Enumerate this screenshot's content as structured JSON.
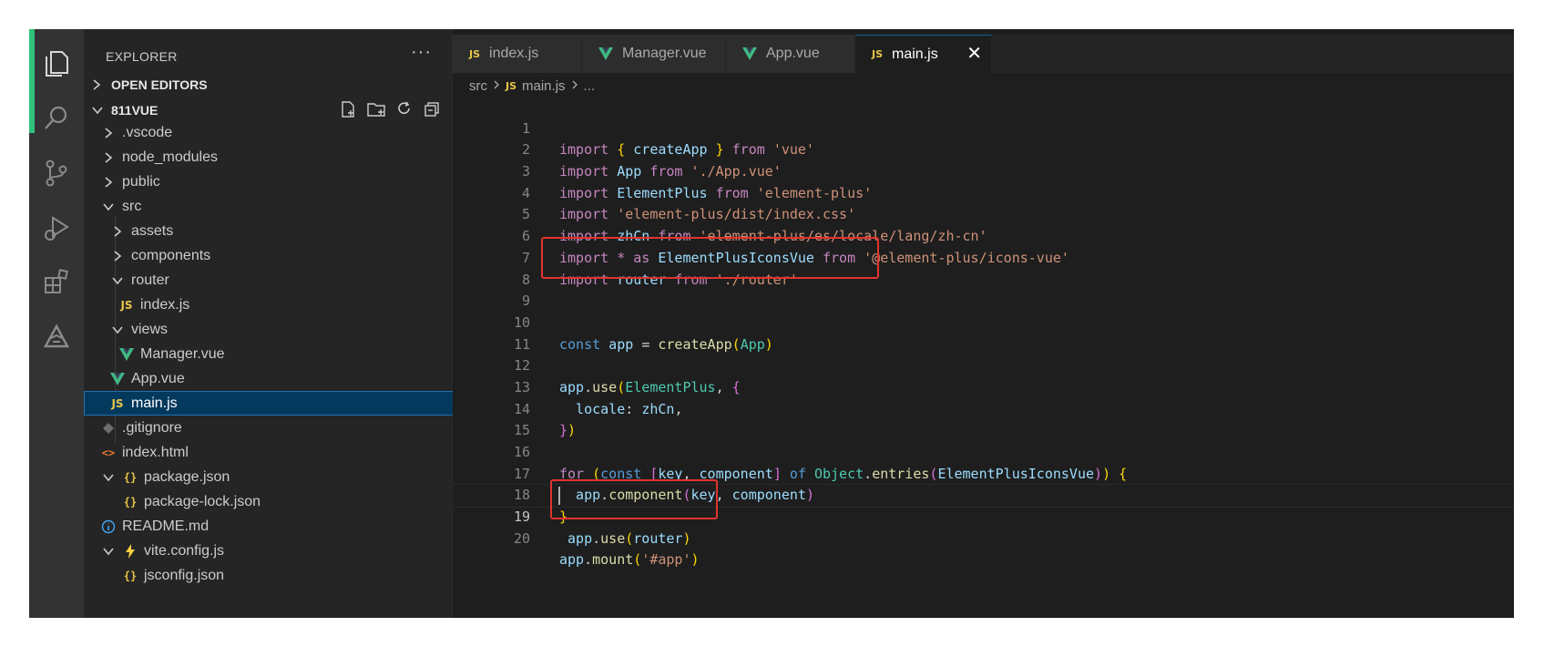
{
  "sidebar": {
    "header": "EXPLORER",
    "more": "···",
    "open_editors": "OPEN EDITORS",
    "project": "811VUE",
    "tree": [
      {
        "label": ".vscode",
        "icon": "chevron-right-icon"
      },
      {
        "label": "node_modules",
        "icon": "chevron-right-icon"
      },
      {
        "label": "public",
        "icon": "chevron-right-icon"
      },
      {
        "label": "src",
        "icon": "chevron-down-icon"
      },
      {
        "label": "assets",
        "icon": "chevron-right-icon"
      },
      {
        "label": "components",
        "icon": "chevron-right-icon"
      },
      {
        "label": "router",
        "icon": "chevron-down-icon"
      },
      {
        "label": "index.js",
        "icon": "js-file-icon"
      },
      {
        "label": "views",
        "icon": "chevron-down-icon"
      },
      {
        "label": "Manager.vue",
        "icon": "vue-file-icon"
      },
      {
        "label": "App.vue",
        "icon": "vue-file-icon"
      },
      {
        "label": "main.js",
        "icon": "js-file-icon"
      },
      {
        "label": ".gitignore",
        "icon": "git-file-icon"
      },
      {
        "label": "index.html",
        "icon": "html-file-icon"
      },
      {
        "label": "package.json",
        "icon": "json-file-icon"
      },
      {
        "label": "package-lock.json",
        "icon": "json-file-icon"
      },
      {
        "label": "README.md",
        "icon": "info-file-icon"
      },
      {
        "label": "vite.config.js",
        "icon": "vite-file-icon"
      },
      {
        "label": "jsconfig.json",
        "icon": "json-file-icon"
      }
    ]
  },
  "tabs": [
    {
      "label": "index.js",
      "icon": "js-file-icon"
    },
    {
      "label": "Manager.vue",
      "icon": "vue-file-icon"
    },
    {
      "label": "App.vue",
      "icon": "vue-file-icon"
    },
    {
      "label": "main.js",
      "icon": "js-file-icon"
    }
  ],
  "breadcrumb": {
    "folder": "src",
    "file": "main.js",
    "rest": "..."
  },
  "icons": {
    "js": "JS",
    "json": "{}",
    "html": "<>"
  },
  "colors": {
    "accent": "#2ec27e",
    "highlight": "#e2332d",
    "selection": "#04395e"
  },
  "code": {
    "line_numbers": [
      "1",
      "2",
      "3",
      "4",
      "5",
      "6",
      "7",
      "8",
      "9",
      "10",
      "11",
      "12",
      "13",
      "14",
      "15",
      "16",
      "17",
      "18",
      "19",
      "20"
    ],
    "l1": [
      "import",
      " ",
      "{",
      " createApp ",
      "}",
      " from ",
      "'vue'"
    ],
    "l2": [
      "import",
      " App ",
      "from",
      " './App.vue'"
    ],
    "l3": [
      "import",
      " ElementPlus ",
      "from",
      " 'element-plus'"
    ],
    "l4": [
      "import",
      " 'element-plus/dist/index.css'"
    ],
    "l5": [
      "import",
      " zhCn ",
      "from",
      " 'element-plus/es/locale/lang/zh-cn'"
    ],
    "l6": [
      "import",
      " * as ",
      "ElementPlusIconsVue",
      " from ",
      "'@element-plus/icons-vue'"
    ],
    "l7": [
      "import",
      " router ",
      "from",
      " './router'"
    ],
    "l10": [
      "const",
      " app ",
      "= ",
      "createApp",
      "(",
      "App",
      ")"
    ],
    "l12": [
      "app",
      ".",
      "use",
      "(",
      "ElementPlus",
      ", ",
      "{"
    ],
    "l13": [
      "  locale",
      ": ",
      "zhCn",
      ","
    ],
    "l14": [
      "}",
      ")"
    ],
    "l16": [
      "for",
      " ",
      "(",
      "const",
      " ",
      "[",
      "key",
      ", ",
      "component",
      "]",
      " of ",
      "Object",
      ".",
      "entries",
      "(",
      "ElementPlusIconsVue",
      ")",
      ")",
      " ",
      "{"
    ],
    "l17": [
      "  app",
      ".",
      "component",
      "(",
      "key",
      ", ",
      "component",
      ")"
    ],
    "l18": [
      "}"
    ],
    "l19": [
      " app",
      ".",
      "use",
      "(",
      "router",
      ")"
    ],
    "l20": [
      "app",
      ".",
      "mount",
      "(",
      "'#app'",
      ")"
    ]
  }
}
